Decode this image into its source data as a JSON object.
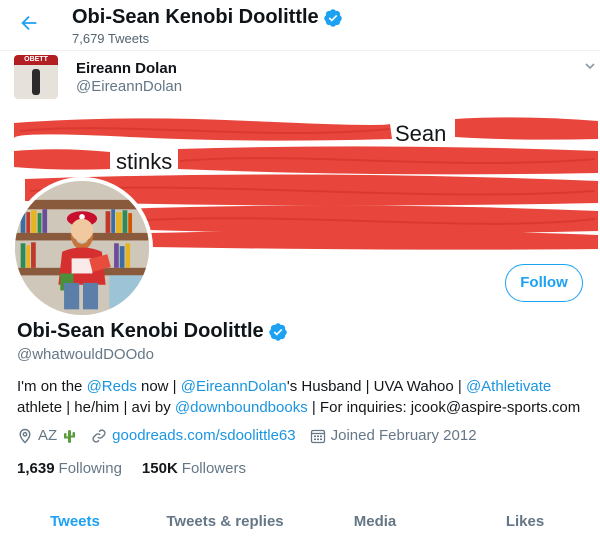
{
  "header": {
    "name": "Obi-Sean Kenobi Doolittle",
    "tweet_count": "7,679 Tweets",
    "back_icon": "arrow-left-icon",
    "accent": "#1da1f2"
  },
  "banner_tweet": {
    "author_name": "Eireann Dolan",
    "author_handle": "@EireannDolan",
    "visible_words": [
      "Sean",
      "stinks"
    ],
    "thumb_sign_text": "OBETT",
    "redaction_color": "#e8453c"
  },
  "profile": {
    "name": "Obi-Sean Kenobi Doolittle",
    "handle": "@whatwouldDOOdo",
    "follow_label": "Follow",
    "bio": {
      "t1": "I'm on the ",
      "reds": "@Reds",
      "t2": " now | ",
      "eireann": "@EireannDolan",
      "t3": "'s Husband | UVA Wahoo | ",
      "athletivate": "@Athletivate",
      "t4": " athlete | he/him | avi by ",
      "downbound": "@downboundbooks",
      "t5": " | For inquiries: jcook@aspire-sports.com"
    },
    "location": "AZ",
    "website": "goodreads.com/sdoolittle63",
    "joined": "Joined February 2012",
    "following_count": "1,639",
    "following_label": "Following",
    "followers_count": "150K",
    "followers_label": "Followers"
  },
  "tabs": [
    {
      "label": "Tweets",
      "active": true
    },
    {
      "label": "Tweets & replies",
      "active": false
    },
    {
      "label": "Media",
      "active": false
    },
    {
      "label": "Likes",
      "active": false
    }
  ]
}
